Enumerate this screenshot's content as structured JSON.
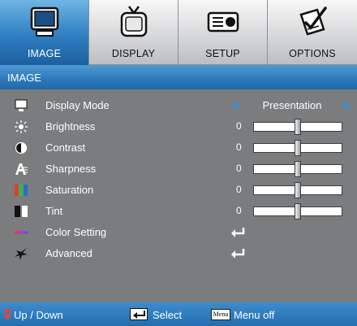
{
  "tabs": [
    {
      "label": "IMAGE",
      "icon": "monitor-icon",
      "active": true
    },
    {
      "label": "DISPLAY",
      "icon": "tv-icon",
      "active": false
    },
    {
      "label": "SETUP",
      "icon": "projector-icon",
      "active": false
    },
    {
      "label": "OPTIONS",
      "icon": "check-pad-icon",
      "active": false
    }
  ],
  "section": {
    "title": "IMAGE"
  },
  "rows": {
    "display_mode": {
      "label": "Display Mode",
      "value": "Presentation",
      "icon": "monitor-small-icon"
    },
    "brightness": {
      "label": "Brightness",
      "value": "0",
      "level": 0.5,
      "icon": "sun-icon"
    },
    "contrast": {
      "label": "Contrast",
      "value": "0",
      "level": 0.5,
      "icon": "half-circle-icon"
    },
    "sharpness": {
      "label": "Sharpness",
      "value": "0",
      "level": 0.5,
      "icon": "sharpness-a-icon"
    },
    "saturation": {
      "label": "Saturation",
      "value": "0",
      "level": 0.5,
      "icon": "color-bars-icon"
    },
    "tint": {
      "label": "Tint",
      "value": "0",
      "level": 0.5,
      "icon": "tint-bars-icon"
    },
    "color_setting": {
      "label": "Color Setting",
      "icon": "color-line-icon",
      "action": "enter-icon"
    },
    "advanced": {
      "label": "Advanced",
      "icon": "star-icon",
      "action": "enter-icon"
    }
  },
  "footer": {
    "updown": "Up / Down",
    "select": "Select",
    "menu_key": "Menu",
    "menu_off": "Menu off"
  },
  "colors": {
    "accent_blue": "#2f7fc2",
    "panel_grey": "#7a7c7e",
    "arrow_blue": "#3a8fd6",
    "footer_arrow_red": "#e0453a"
  }
}
